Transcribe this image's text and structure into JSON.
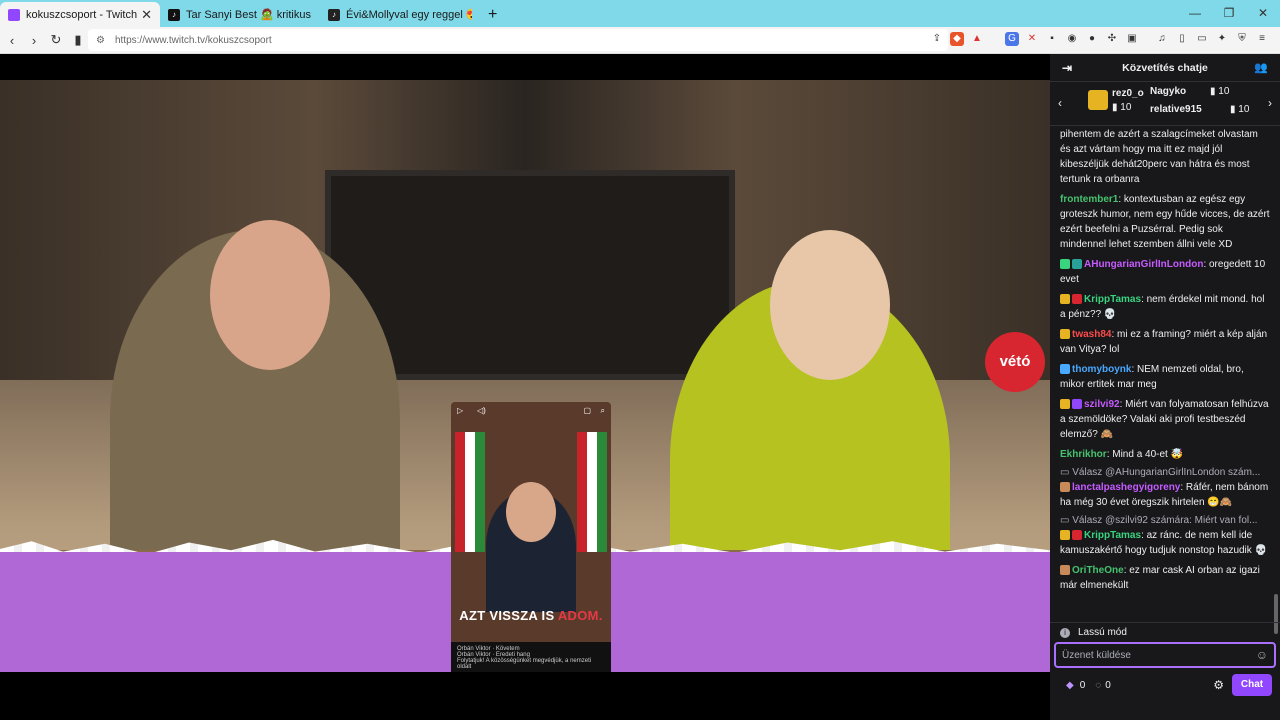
{
  "tabs": [
    {
      "title": "kokuszcsoport - Twitch",
      "active": true,
      "favicon_color": "#9147ff"
    },
    {
      "title": "Tar Sanyi Best 🧟 kritikus 🧟 (@szop",
      "active": false,
      "favicon_color": "#111111"
    },
    {
      "title": "Évi&Mollyval egy reggel 😍😂 (@m",
      "active": false,
      "favicon_color": "#222222"
    }
  ],
  "browser": {
    "url": "https://www.twitch.tv/kokuszcsoport"
  },
  "video": {
    "clip_caption_pre": "AZT VISSZA IS ",
    "clip_caption_hl": "ADOM.",
    "clip_author": "Orbán Viktor",
    "clip_follow": "Követem",
    "clip_text": "Folytatjuk! A közösségünket megvédjük, a nemzeti oldalt",
    "clip_sub": "Orbán Viktor · Eredeti hang",
    "brand": "vétó"
  },
  "chat": {
    "header": "Közvetítés chatje",
    "leaderboard": [
      {
        "name": "rez0_o",
        "count": "10"
      },
      {
        "name": "Nagyko",
        "count": "10"
      },
      {
        "name": "relative915",
        "count": "10"
      }
    ],
    "messages": [
      {
        "user": "",
        "color": "#efeff1",
        "text": "pihentem de azért a szalagcímeket olvastam és azt vártam hogy ma itt ez majd jól kibeszéljük dehát20perc van hátra és most tertunk ra orbanra"
      },
      {
        "user": "frontember1",
        "color": "#46c26e",
        "text": ": kontextusban az egész egy groteszk humor, nem egy hűde vicces, de azért ezért beefelni a Puzsérral. Pedig sok mindennel lehet szemben állni vele XD"
      },
      {
        "user": "AHungarianGirlInLondon",
        "color": "#c65bff",
        "text": ": oregedett 10 evet"
      },
      {
        "user": "KrippTamas",
        "color": "#3ad37e",
        "text": ": nem érdekel mit mond. hol a pénz?? 💀"
      },
      {
        "user": "twash84",
        "color": "#ff4a4a",
        "text": ": mi ez a framing? miért a kép alján van Vitya? lol"
      },
      {
        "user": "thomyboynk",
        "color": "#49a8ff",
        "text": ": NEM nemzeti oldal, bro, mikor ertitek mar meg"
      },
      {
        "user": "szilvi92",
        "color": "#c65bff",
        "text": ": Miért van folyamatosan felhúzva a szemöldöke? Valaki aki profi testbeszéd elemző? 🙈"
      },
      {
        "user": "Ekhrikhor",
        "color": "#46c26e",
        "text": ": Mind a 40-et 🤯"
      },
      {
        "reply": "Válasz @AHungarianGirlInLondon szám..."
      },
      {
        "user": "lanctalpashegyigoreny",
        "color": "#c65bff",
        "text": ": Ráfér, nem bánom ha még 30 évet öregszik hirtelen 😁🙈"
      },
      {
        "reply": "Válasz @szilvi92 számára: Miért van fol..."
      },
      {
        "user": "KrippTamas",
        "color": "#3ad37e",
        "text": ": az ránc. de nem kell ide kamuszakértő hogy tudjuk nonstop hazudik 💀"
      },
      {
        "user": "OriTheOne",
        "color": "#46c26e",
        "text": ": ez mar cask AI orban az igazi már elmenekült"
      }
    ],
    "slow_mode": "Lassú mód",
    "input_placeholder": "Üzenet küldése",
    "points": "0",
    "bits": "0",
    "send_label": "Chat"
  }
}
